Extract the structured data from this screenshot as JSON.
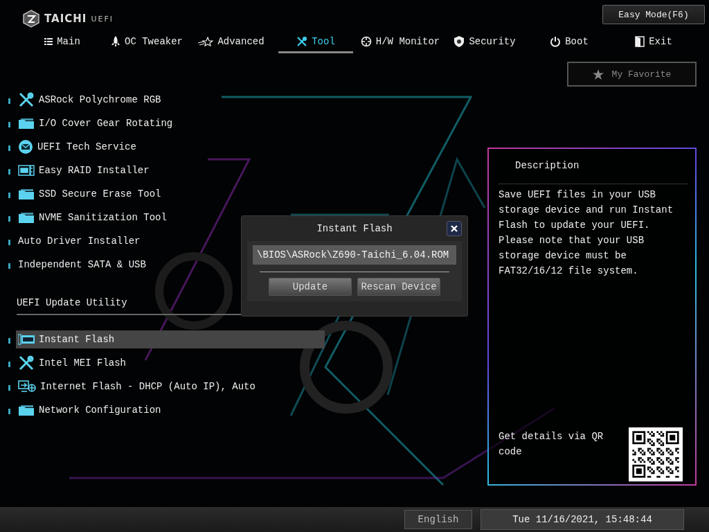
{
  "header": {
    "logo": "TAICHI",
    "logo_suffix": "UEFI",
    "easy_mode_button": "Easy Mode(F6)"
  },
  "tabs": [
    {
      "label": "Main",
      "kind": "list",
      "selected": false
    },
    {
      "label": "OC Tweaker",
      "kind": "rocket",
      "selected": false
    },
    {
      "label": "Advanced",
      "kind": "star",
      "selected": false
    },
    {
      "label": "Tool",
      "kind": "tools",
      "selected": true
    },
    {
      "label": "H/W Monitor",
      "kind": "target",
      "selected": false
    },
    {
      "label": "Security",
      "kind": "shield",
      "selected": false
    },
    {
      "label": "Boot",
      "kind": "power",
      "selected": false
    },
    {
      "label": "Exit",
      "kind": "door",
      "selected": false
    }
  ],
  "favorite_button": "My Favorite",
  "menu": [
    {
      "label": "ASRock Polychrome RGB",
      "kind": "tools",
      "selected": false
    },
    {
      "label": "I/O Cover Gear Rotating",
      "kind": "folder",
      "selected": false
    },
    {
      "label": "UEFI Tech Service",
      "kind": "mail",
      "selected": false
    },
    {
      "label": "Easy RAID Installer",
      "kind": "raid",
      "selected": false
    },
    {
      "label": "SSD Secure Erase Tool",
      "kind": "folder",
      "selected": false
    },
    {
      "label": "NVME Sanitization Tool",
      "kind": "folder",
      "selected": false
    },
    {
      "label": "Auto Driver Installer",
      "kind": "plain",
      "selected": false
    },
    {
      "label": "Independent SATA & USB",
      "kind": "plain",
      "selected": false
    }
  ],
  "section": {
    "title": "UEFI Update Utility",
    "items": [
      {
        "label": "Instant Flash",
        "kind": "bios",
        "selected": true
      },
      {
        "label": "Intel MEI Flash",
        "kind": "tools",
        "selected": false
      },
      {
        "label": "Internet Flash - DHCP (Auto IP), Auto",
        "kind": "network",
        "selected": false
      },
      {
        "label": "Network Configuration",
        "kind": "folder",
        "selected": false
      }
    ]
  },
  "description": {
    "title": "Description",
    "text": "Save UEFI files in your USB storage device and run Instant Flash to update your UEFI. Please note that your USB storage device must be FAT32/16/12 file system.",
    "qr_caption": "Get details via QR code"
  },
  "dialog": {
    "title": "Instant Flash",
    "path": "\\BIOS\\ASRock\\Z690-Taichi_6.04.ROM",
    "buttons": [
      "Update",
      "Rescan Device"
    ]
  },
  "status_bar": {
    "language": "English",
    "datetime": "Tue 11/16/2021, 15:48:44"
  }
}
